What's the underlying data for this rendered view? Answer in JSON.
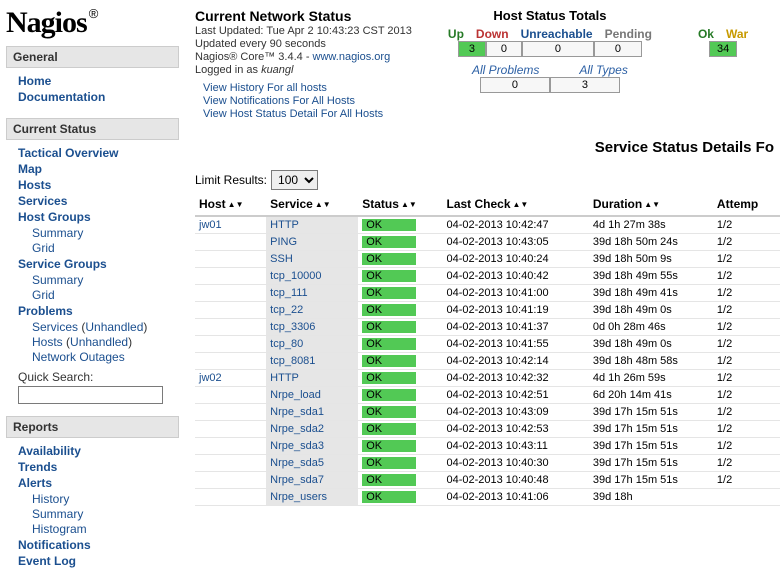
{
  "logo": {
    "text": "Nagios",
    "reg": "®"
  },
  "nav": [
    {
      "header": "General",
      "items": [
        {
          "label": "Home",
          "type": "item"
        },
        {
          "label": "Documentation",
          "type": "item"
        }
      ]
    },
    {
      "header": "Current Status",
      "items": [
        {
          "label": "Tactical Overview",
          "type": "item"
        },
        {
          "label": "Map",
          "type": "item"
        },
        {
          "label": "Hosts",
          "type": "item"
        },
        {
          "label": "Services",
          "type": "item"
        },
        {
          "label": "Host Groups",
          "type": "item"
        },
        {
          "label": "Summary",
          "type": "sub"
        },
        {
          "label": "Grid",
          "type": "sub"
        },
        {
          "label": "Service Groups",
          "type": "item"
        },
        {
          "label": "Summary",
          "type": "sub"
        },
        {
          "label": "Grid",
          "type": "sub"
        },
        {
          "label": "Problems",
          "type": "item"
        },
        {
          "label": "Services (Unhandled)",
          "type": "sub-mixed",
          "main": "Services",
          "paren_open": " (",
          "inner": "Unhandled",
          "paren_close": ")"
        },
        {
          "label": "Hosts (Unhandled)",
          "type": "sub-mixed",
          "main": "Hosts",
          "paren_open": " (",
          "inner": "Unhandled",
          "paren_close": ")"
        },
        {
          "label": "Network Outages",
          "type": "sub"
        }
      ],
      "quick_search": "Quick Search:"
    },
    {
      "header": "Reports",
      "items": [
        {
          "label": "Availability",
          "type": "item"
        },
        {
          "label": "Trends",
          "type": "item"
        },
        {
          "label": "Alerts",
          "type": "item"
        },
        {
          "label": "History",
          "type": "sub"
        },
        {
          "label": "Summary",
          "type": "sub"
        },
        {
          "label": "Histogram",
          "type": "sub"
        },
        {
          "label": "Notifications",
          "type": "item"
        },
        {
          "label": "Event Log",
          "type": "item"
        }
      ]
    }
  ],
  "status": {
    "title": "Current Network Status",
    "last_updated": "Last Updated: Tue Apr 2 10:43:23 CST 2013",
    "update_freq": "Updated every 90 seconds",
    "core_prefix": "Nagios® Core™ 3.4.4 - ",
    "core_link": "www.nagios.org",
    "logged_in_prefix": "Logged in as ",
    "logged_in_user": "kuangl",
    "links": [
      "View History For all hosts",
      "View Notifications For All Hosts",
      "View Host Status Detail For All Hosts"
    ]
  },
  "host_totals": {
    "title": "Host Status Totals",
    "headers": {
      "up": "Up",
      "down": "Down",
      "unreachable": "Unreachable",
      "pending": "Pending"
    },
    "values": {
      "up": "3",
      "down": "0",
      "unreachable": "0",
      "pending": "0"
    },
    "problems_label": "All Problems",
    "types_label": "All Types",
    "problems_value": "0",
    "types_value": "3"
  },
  "svc_totals": {
    "headers": {
      "ok": "Ok",
      "warn": "War"
    },
    "values": {
      "ok": "34"
    }
  },
  "detail_header": "Service Status Details Fo",
  "limit": {
    "label": "Limit Results:",
    "value": "100"
  },
  "table": {
    "cols": {
      "host": "Host",
      "service": "Service",
      "status": "Status",
      "last_check": "Last Check",
      "duration": "Duration",
      "attempt": "Attemp"
    },
    "rows": [
      {
        "host": "jw01",
        "service": "HTTP",
        "status": "OK",
        "last_check": "04-02-2013 10:42:47",
        "duration": "4d 1h 27m 38s",
        "attempt": "1/2"
      },
      {
        "host": "",
        "service": "PING",
        "status": "OK",
        "last_check": "04-02-2013 10:43:05",
        "duration": "39d 18h 50m 24s",
        "attempt": "1/2"
      },
      {
        "host": "",
        "service": "SSH",
        "status": "OK",
        "last_check": "04-02-2013 10:40:24",
        "duration": "39d 18h 50m 9s",
        "attempt": "1/2"
      },
      {
        "host": "",
        "service": "tcp_10000",
        "status": "OK",
        "last_check": "04-02-2013 10:40:42",
        "duration": "39d 18h 49m 55s",
        "attempt": "1/2"
      },
      {
        "host": "",
        "service": "tcp_111",
        "status": "OK",
        "last_check": "04-02-2013 10:41:00",
        "duration": "39d 18h 49m 41s",
        "attempt": "1/2"
      },
      {
        "host": "",
        "service": "tcp_22",
        "status": "OK",
        "last_check": "04-02-2013 10:41:19",
        "duration": "39d 18h 49m 0s",
        "attempt": "1/2"
      },
      {
        "host": "",
        "service": "tcp_3306",
        "status": "OK",
        "last_check": "04-02-2013 10:41:37",
        "duration": "0d 0h 28m 46s",
        "attempt": "1/2"
      },
      {
        "host": "",
        "service": "tcp_80",
        "status": "OK",
        "last_check": "04-02-2013 10:41:55",
        "duration": "39d 18h 49m 0s",
        "attempt": "1/2"
      },
      {
        "host": "",
        "service": "tcp_8081",
        "status": "OK",
        "last_check": "04-02-2013 10:42:14",
        "duration": "39d 18h 48m 58s",
        "attempt": "1/2"
      },
      {
        "host": "jw02",
        "service": "HTTP",
        "status": "OK",
        "last_check": "04-02-2013 10:42:32",
        "duration": "4d 1h 26m 59s",
        "attempt": "1/2"
      },
      {
        "host": "",
        "service": "Nrpe_load",
        "status": "OK",
        "last_check": "04-02-2013 10:42:51",
        "duration": "6d 20h 14m 41s",
        "attempt": "1/2"
      },
      {
        "host": "",
        "service": "Nrpe_sda1",
        "status": "OK",
        "last_check": "04-02-2013 10:43:09",
        "duration": "39d 17h 15m 51s",
        "attempt": "1/2"
      },
      {
        "host": "",
        "service": "Nrpe_sda2",
        "status": "OK",
        "last_check": "04-02-2013 10:42:53",
        "duration": "39d 17h 15m 51s",
        "attempt": "1/2"
      },
      {
        "host": "",
        "service": "Nrpe_sda3",
        "status": "OK",
        "last_check": "04-02-2013 10:43:11",
        "duration": "39d 17h 15m 51s",
        "attempt": "1/2"
      },
      {
        "host": "",
        "service": "Nrpe_sda5",
        "status": "OK",
        "last_check": "04-02-2013 10:40:30",
        "duration": "39d 17h 15m 51s",
        "attempt": "1/2"
      },
      {
        "host": "",
        "service": "Nrpe_sda7",
        "status": "OK",
        "last_check": "04-02-2013 10:40:48",
        "duration": "39d 17h 15m 51s",
        "attempt": "1/2"
      },
      {
        "host": "",
        "service": "Nrpe_users",
        "status": "OK",
        "last_check": "04-02-2013 10:41:06",
        "duration": "39d 18h",
        "attempt": ""
      }
    ]
  }
}
